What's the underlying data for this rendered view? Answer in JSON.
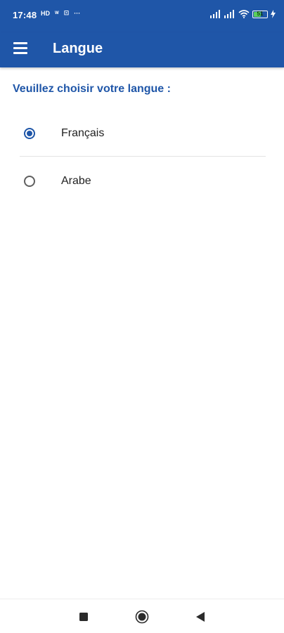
{
  "status_bar": {
    "time": "17:48",
    "left_icons": [
      "sim-icon",
      "signal-text-icon",
      "notification-icon",
      "more-dots-icon"
    ],
    "left_icon_texts": [
      "HD",
      "ᵂ",
      "⊡",
      "···"
    ],
    "battery": "51",
    "battery_color": "#5bd05b"
  },
  "app_bar": {
    "title": "Langue",
    "color": "#1f56a8"
  },
  "content": {
    "prompt": "Veuillez choisir votre langue :",
    "options": [
      {
        "label": "Français",
        "selected": true
      },
      {
        "label": "Arabe",
        "selected": false
      }
    ]
  },
  "nav_bar": {
    "buttons": [
      "recents-square-icon",
      "home-circle-icon",
      "back-triangle-icon"
    ]
  }
}
